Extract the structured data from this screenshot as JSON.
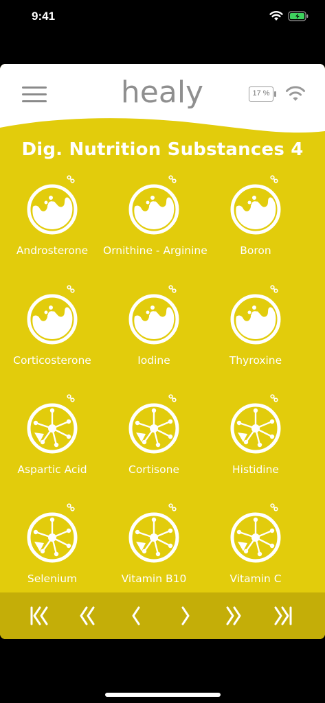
{
  "status_bar": {
    "time": "9:41"
  },
  "header": {
    "logo_text": "healy",
    "battery_percent": "17 %"
  },
  "page": {
    "title": "Dig. Nutrition Substances 4"
  },
  "colors": {
    "card": "#e2cc0c",
    "nav_bar": "#c4ae08",
    "header": "#ffffff",
    "text": "#ffffff"
  },
  "items": [
    {
      "label": "Androsterone",
      "icon": "gland-icon"
    },
    {
      "label": "Ornithine - Arginine",
      "icon": "gland-icon"
    },
    {
      "label": "Boron",
      "icon": "gland-icon"
    },
    {
      "label": "Corticosterone",
      "icon": "gland-icon"
    },
    {
      "label": "Iodine",
      "icon": "gland-icon"
    },
    {
      "label": "Thyroxine",
      "icon": "gland-icon"
    },
    {
      "label": "Aspartic Acid",
      "icon": "cell-network-icon"
    },
    {
      "label": "Cortisone",
      "icon": "cell-network-icon"
    },
    {
      "label": "Histidine",
      "icon": "cell-network-icon"
    },
    {
      "label": "Selenium",
      "icon": "cell-network-icon"
    },
    {
      "label": "Vitamin B10",
      "icon": "cell-network-icon"
    },
    {
      "label": "Vitamin C",
      "icon": "cell-network-icon"
    }
  ],
  "nav": [
    "first-page-icon",
    "previous-section-icon",
    "previous-icon",
    "next-icon",
    "next-section-icon",
    "last-page-icon"
  ]
}
